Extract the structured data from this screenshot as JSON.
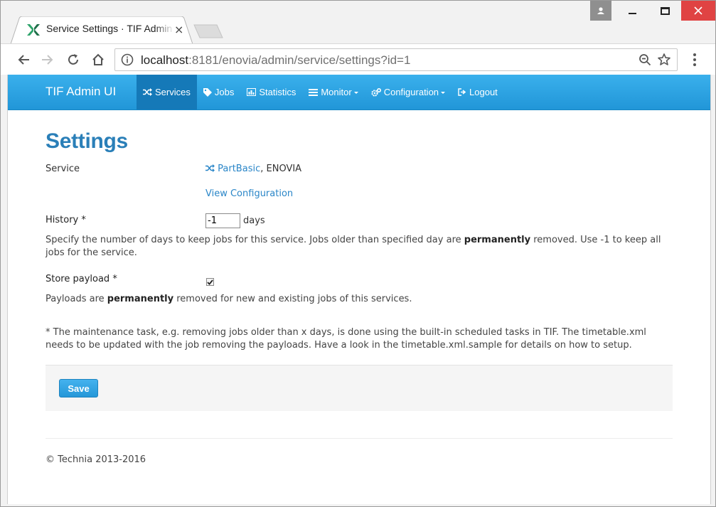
{
  "browser": {
    "tab_title": "Service Settings · TIF Admin UI",
    "tab_close": "×",
    "url_host": "localhost",
    "url_rest": ":8181/enovia/admin/service/settings?id=1"
  },
  "navbar": {
    "brand": "TIF Admin UI",
    "items": [
      {
        "label": "Services",
        "icon": "shuffle-icon",
        "active": true
      },
      {
        "label": "Jobs",
        "icon": "tag-icon"
      },
      {
        "label": "Statistics",
        "icon": "bar-chart-icon"
      },
      {
        "label": "Monitor",
        "icon": "list-icon",
        "dropdown": true
      },
      {
        "label": "Configuration",
        "icon": "gears-icon",
        "dropdown": true
      },
      {
        "label": "Logout",
        "icon": "logout-icon"
      }
    ]
  },
  "page": {
    "title": "Settings",
    "service_label": "Service",
    "service_link": "PartBasic",
    "service_suffix": ", ENOVIA",
    "view_configuration": "View Configuration",
    "history_label": "History *",
    "history_value": "-1",
    "history_unit": "days",
    "history_help_1": "Specify the number of days to keep jobs for this service. Jobs older than specified day are ",
    "history_help_bold": "permanently",
    "history_help_2": " removed. Use -1 to keep all jobs for the service.",
    "payload_label": "Store payload *",
    "payload_checked": true,
    "payload_help_1": "Payloads are ",
    "payload_help_bold": "permanently",
    "payload_help_2": " removed for new and existing jobs of this services.",
    "note": "* The maintenance task, e.g. removing jobs older than x days, is done using the built-in scheduled tasks in TIF. The timetable.xml needs to be updated with the job removing the payloads. Have a look in the timetable.xml.sample for details on how to setup.",
    "save_label": "Save",
    "footer": "© Technia 2013-2016"
  },
  "colors": {
    "navbar": "#2a9fe0",
    "navbar_active": "#1579b8",
    "title": "#2a7fb8",
    "link": "#2a86c8"
  }
}
